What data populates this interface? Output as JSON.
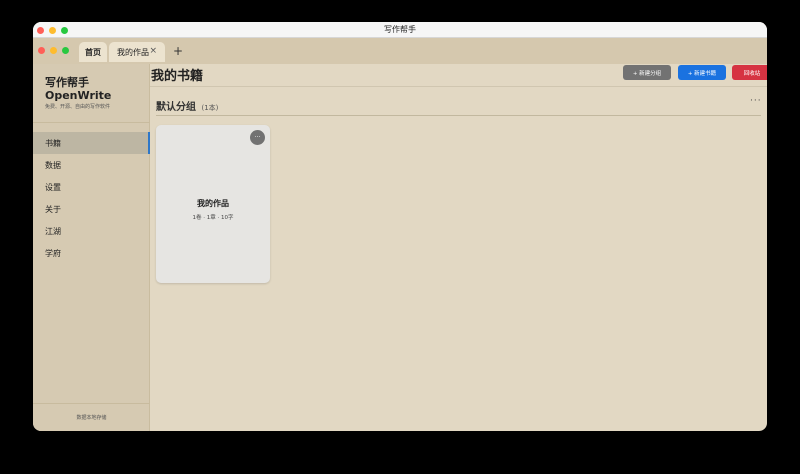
{
  "window": {
    "title": "写作帮手"
  },
  "tabs": [
    {
      "label": "首页"
    },
    {
      "label": "我的作品",
      "close": "×"
    }
  ],
  "new_tab": "+",
  "sidebar": {
    "app_name": "写作帮手",
    "app_name_en": "OpenWrite",
    "tagline": "免费、开源、自由的写作软件",
    "items": [
      {
        "label": "书籍"
      },
      {
        "label": "数据"
      },
      {
        "label": "设置"
      },
      {
        "label": "关于"
      },
      {
        "label": "江湖"
      },
      {
        "label": "学府"
      }
    ],
    "footer": "数据本地存储"
  },
  "main": {
    "title": "我的书籍",
    "buttons": {
      "new_group": "+ 新建分组",
      "new_book": "+ 新建书籍",
      "recycle": "回收站"
    },
    "group": {
      "title": "默认分组",
      "count": "(1本)",
      "more": "···"
    },
    "book": {
      "title": "我的作品",
      "meta": "1卷 · 1章 · 10字",
      "more": "···"
    }
  },
  "colors": {
    "background": "#e2d8c3",
    "sidebar": "#d6cab2",
    "primary": "#1a72e0",
    "danger": "#d63342",
    "neutral": "#727272",
    "active_indicator": "#2e77c8"
  }
}
